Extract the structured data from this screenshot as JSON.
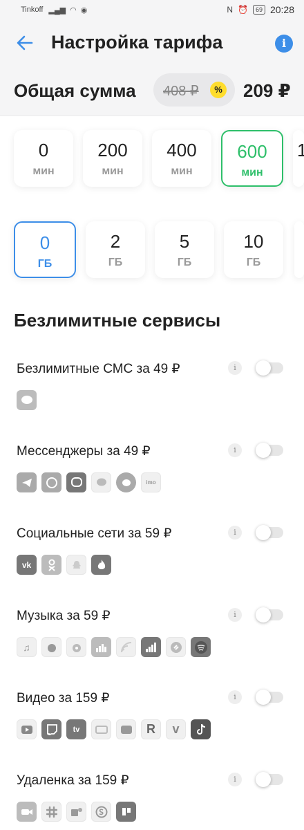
{
  "status_bar": {
    "carrier": "Tinkoff",
    "battery": "69",
    "time": "20:28"
  },
  "header": {
    "title": "Настройка тарифа",
    "info_glyph": "i"
  },
  "total": {
    "label": "Общая сумма",
    "old_price": "408 ₽",
    "discount_glyph": "%",
    "new_price": "209 ₽"
  },
  "minutes": [
    {
      "value": "0",
      "unit": "мин"
    },
    {
      "value": "200",
      "unit": "мин"
    },
    {
      "value": "400",
      "unit": "мин"
    },
    {
      "value": "600",
      "unit": "мин",
      "selected": true
    },
    {
      "value": "1",
      "unit": ""
    }
  ],
  "gigabytes": [
    {
      "value": "0",
      "unit": "ГБ",
      "selected": true
    },
    {
      "value": "2",
      "unit": "ГБ"
    },
    {
      "value": "5",
      "unit": "ГБ"
    },
    {
      "value": "10",
      "unit": "ГБ"
    },
    {
      "value": "",
      "unit": ""
    }
  ],
  "section_title": "Безлимитные сервисы",
  "services": [
    {
      "label": "Безлимитные СМС за 49 ₽",
      "info": "i",
      "enabled": false,
      "icons": [
        "sms-icon"
      ]
    },
    {
      "label": "Мессенджеры за 49 ₽",
      "info": "i",
      "enabled": false,
      "icons": [
        "telegram-icon",
        "whatsapp-icon",
        "viber-icon",
        "tamtam-icon",
        "messenger-icon",
        "imo-icon"
      ]
    },
    {
      "label": "Социальные сети за 59 ₽",
      "info": "i",
      "enabled": false,
      "icons": [
        "vk-icon",
        "odnoklassniki-icon",
        "snapchat-icon",
        "tinder-icon"
      ]
    },
    {
      "label": "Музыка за 59 ₽",
      "info": "i",
      "enabled": false,
      "icons": [
        "apple-music-icon",
        "yandex-music-icon",
        "music-player-icon",
        "deezer-icon",
        "podcasts-icon",
        "zvooq-icon",
        "shazam-icon",
        "spotify-icon"
      ]
    },
    {
      "label": "Видео за 159 ₽",
      "info": "i",
      "enabled": false,
      "icons": [
        "youtube-icon",
        "twitch-icon",
        "apple-tv-icon",
        "video-player-icon",
        "youtube-kids-icon",
        "rutube-icon",
        "vimeo-icon",
        "tiktok-icon"
      ]
    },
    {
      "label": "Удаленка за 159 ₽",
      "info": "i",
      "enabled": false,
      "icons": [
        "zoom-icon",
        "slack-icon",
        "teams-icon",
        "skype-icon",
        "trello-icon"
      ]
    }
  ],
  "icon_glyphs": {
    "rutube": "R",
    "vimeo": "v",
    "vk": "vk",
    "imo": "imo",
    "apple_tv": "tv"
  },
  "colors": {
    "accent_blue": "#3d8ee8",
    "accent_green": "#2ebf6a",
    "discount_yellow": "#ffdd2d"
  }
}
